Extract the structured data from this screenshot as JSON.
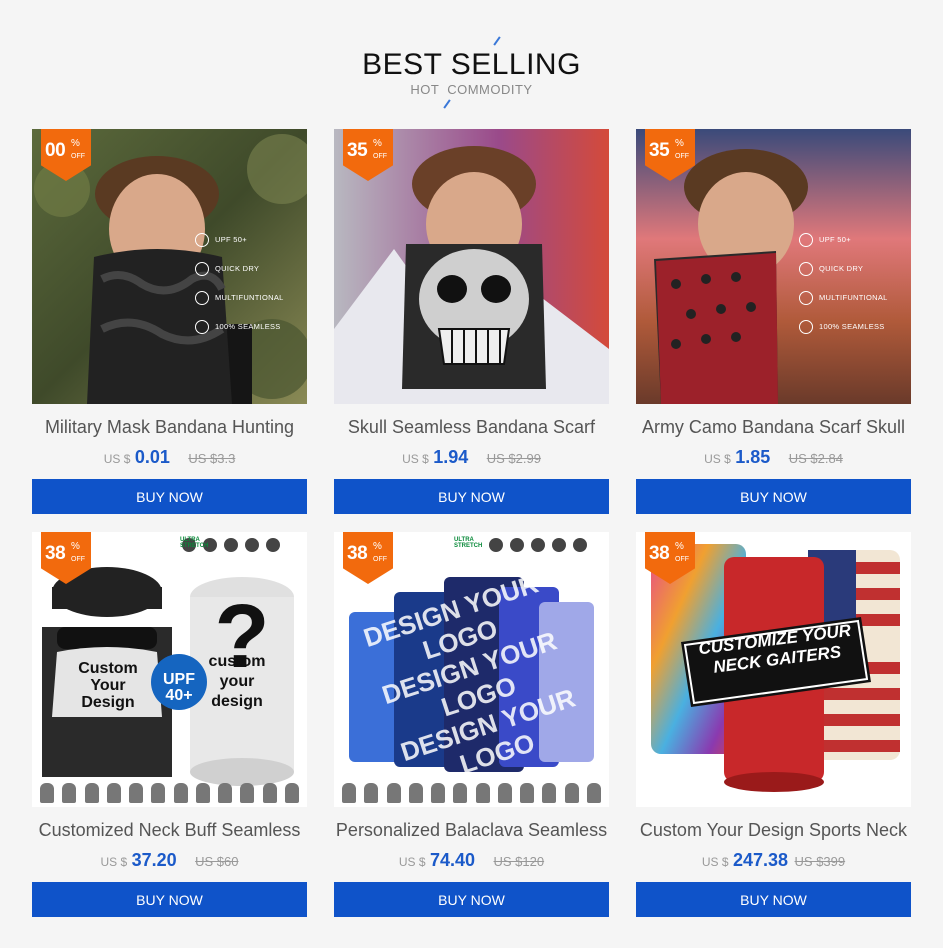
{
  "header": {
    "title": "BEST SELLING",
    "subtitle": "HOT COMMODITY"
  },
  "currency_label": "US $",
  "buy_label": "BUY NOW",
  "features": {
    "upf": "UPF 50+",
    "dry": "QUICK DRY",
    "multi": "MULTIFUNTIONAL",
    "seamless": "100% SEAMLESS"
  },
  "products": [
    {
      "name": "Military Mask Bandana Hunting",
      "discount": "00",
      "price": "0.01",
      "old_price": "US $3.3"
    },
    {
      "name": "Skull Seamless Bandana Scarf",
      "discount": "35",
      "price": "1.94",
      "old_price": "US $2.99"
    },
    {
      "name": "Army Camo Bandana Scarf Skull",
      "discount": "35",
      "price": "1.85",
      "old_price": "US $2.84"
    },
    {
      "name": "Customized Neck Buff Seamless",
      "discount": "38",
      "price": "37.20",
      "old_price": "US $60"
    },
    {
      "name": "Personalized Balaclava Seamless",
      "discount": "38",
      "price": "74.40",
      "old_price": "US $120"
    },
    {
      "name": "Custom Your Design Sports Neck",
      "discount": "38",
      "price": "247.38",
      "old_price": "US $399"
    }
  ],
  "ribbon": {
    "pct": "%",
    "off": "OFF"
  },
  "photo4": {
    "upf": "UPF 40+",
    "left": "Custom Your Design",
    "right": "custom your design",
    "brand": "ULTRA STRETCH"
  },
  "photo5": {
    "text": "DESIGN YOUR LOGO",
    "brand": "ULTRA STRETCH"
  },
  "photo6": {
    "text": "CUSTOMIZE YOUR NECK GAITERS"
  }
}
